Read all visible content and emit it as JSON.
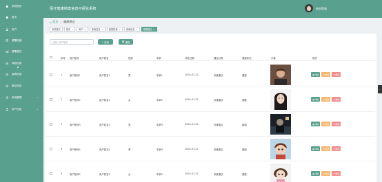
{
  "header": {
    "system_title": "医疗健康档案信息可视化系统",
    "user_name": "退出登录"
  },
  "sidebar": {
    "items": [
      {
        "label": "系统首页",
        "icon": "home-icon"
      },
      {
        "label": "首页",
        "icon": "home-icon"
      },
      {
        "label": "用户",
        "icon": "user-icon"
      },
      {
        "label": "健康档案",
        "icon": "file-icon"
      },
      {
        "label": "健康建议",
        "icon": "book-icon"
      },
      {
        "label": "体检信息",
        "icon": "list-icon"
      },
      {
        "label": "疾病信息",
        "icon": "list-icon"
      },
      {
        "label": "就诊信息",
        "icon": "list-icon"
      },
      {
        "label": "系统管理",
        "icon": "gear-icon"
      },
      {
        "label": "用户信息",
        "icon": "user-icon"
      }
    ]
  },
  "breadcrumb": {
    "home": "首页",
    "current": "健康建议"
  },
  "tags": [
    {
      "label": "系统首页"
    },
    {
      "label": "首页"
    },
    {
      "label": "用户"
    },
    {
      "label": "疾病信息"
    },
    {
      "label": "健康档案"
    },
    {
      "label": "疾病信息"
    },
    {
      "label": "健康建议"
    }
  ],
  "toolbar": {
    "search_placeholder": "请输入用户账号",
    "query_label": "查询",
    "delete_label": "删除"
  },
  "table": {
    "columns": [
      "序号",
      "用户账号",
      "用户姓名",
      "性别",
      "年龄",
      "评估日期",
      "建议分类",
      "健康状况",
      "头像",
      "操作"
    ],
    "rows": [
      {
        "index": "1",
        "account": "用户账号1",
        "name": "用户姓名1",
        "gender": "男",
        "age": "年龄1",
        "date": "2024-01-22",
        "category": "饮食建议",
        "status": "健康",
        "photo": "brown-hair-man"
      },
      {
        "index": "2",
        "account": "用户账号2",
        "name": "用户姓名2",
        "gender": "女",
        "age": "年龄2",
        "date": "2024-01-22",
        "category": "饮食建议",
        "status": "健康",
        "photo": "long-hair-woman"
      },
      {
        "index": "3",
        "account": "用户账号3",
        "name": "用户姓名3",
        "gender": "男",
        "age": "年龄3",
        "date": "2024-01-22",
        "category": "饮食建议",
        "status": "健康",
        "photo": "dark-photo"
      },
      {
        "index": "4",
        "account": "用户账号4",
        "name": "用户姓名4",
        "gender": "男",
        "age": "年龄4",
        "date": "2024-01-22",
        "category": "饮食建议",
        "status": "健康",
        "photo": "cartoon-character"
      },
      {
        "index": "5",
        "account": "用户账号5",
        "name": "用户姓名5",
        "gender": "女",
        "age": "年龄5",
        "date": "2024-01-22",
        "category": "饮食建议",
        "status": "健康",
        "photo": "cartoon-girl"
      }
    ],
    "actions": {
      "view": "详情",
      "edit": "修改",
      "delete": "删除"
    }
  },
  "colors": {
    "primary": "#5aa08e",
    "edit": "#f2b86e",
    "delete": "#f08c8c"
  }
}
